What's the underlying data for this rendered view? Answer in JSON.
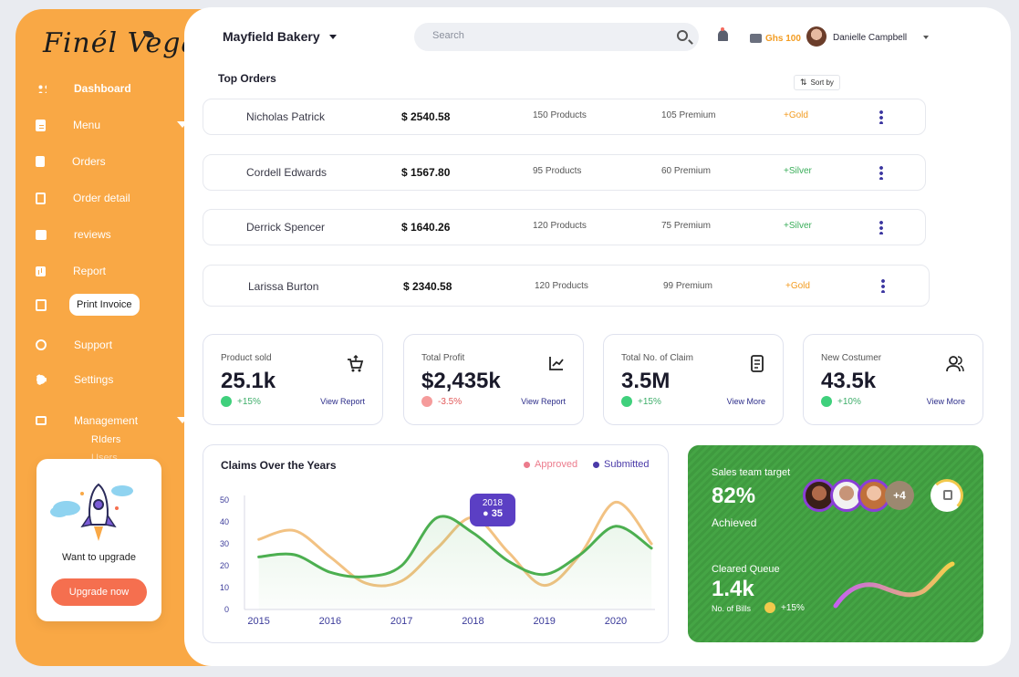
{
  "brand": {
    "logo_text": "Finél Vegan"
  },
  "sidebar": {
    "items": [
      {
        "label": "Dashboard",
        "icon": "grid-icon"
      },
      {
        "label": "Menu",
        "icon": "document-icon"
      },
      {
        "label": "Orders",
        "icon": "bookmark-icon"
      },
      {
        "label": "Order detail",
        "icon": "clipboard-icon"
      },
      {
        "label": "reviews",
        "icon": "edit-icon"
      },
      {
        "label": "Report",
        "icon": "bar-chart-icon"
      },
      {
        "label": "Print Invoice",
        "icon": "invoice-icon"
      },
      {
        "label": "Support",
        "icon": "support-icon"
      },
      {
        "label": "Settings",
        "icon": "gear-icon"
      },
      {
        "label": "Management",
        "icon": "monitor-icon"
      }
    ],
    "sub_items": [
      "RIders",
      "Users"
    ]
  },
  "upgrade": {
    "text": "Want to upgrade",
    "button": "Upgrade now"
  },
  "header": {
    "store": "Mayfield Bakery",
    "search_placeholder": "Search",
    "balance": "Ghs 100",
    "user": "Danielle Campbell"
  },
  "orders": {
    "title": "Top Orders",
    "sort_label": "Sort by",
    "rows": [
      {
        "name": "Nicholas Patrick",
        "amount": "$ 2540.58",
        "products": "150 Products",
        "premium": "105 Premium",
        "tier": "+Gold"
      },
      {
        "name": "Cordell Edwards",
        "amount": "$ 1567.80",
        "products": "95 Products",
        "premium": "60 Premium",
        "tier": "+Silver"
      },
      {
        "name": "Derrick Spencer",
        "amount": "$ 1640.26",
        "products": "120 Products",
        "premium": "75 Premium",
        "tier": "+Silver"
      },
      {
        "name": "Larissa Burton",
        "amount": "$ 2340.58",
        "products": "120 Products",
        "premium": "99 Premium",
        "tier": "+Gold"
      }
    ]
  },
  "stats": [
    {
      "label": "Product sold",
      "value": "25.1k",
      "delta": "+15%",
      "link": "View Report",
      "icon": "cart-icon"
    },
    {
      "label": "Total Profit",
      "value": "$2,435k",
      "delta": "-3.5%",
      "link": "View Report",
      "icon": "trend-icon"
    },
    {
      "label": "Total No. of Claim",
      "value": "3.5M",
      "delta": "+15%",
      "link": "View More",
      "icon": "receipt-icon"
    },
    {
      "label": "New Costumer",
      "value": "43.5k",
      "delta": "+10%",
      "link": "View More",
      "icon": "users-icon"
    }
  ],
  "claims": {
    "title": "Claims Over the Years",
    "tooltip_year": "2018",
    "tooltip_value": "● 35"
  },
  "chart_data": {
    "type": "line",
    "title": "Claims Over the Years",
    "x": [
      2015,
      2015.5,
      2016,
      2016.5,
      2017,
      2017.5,
      2018,
      2018.5,
      2019,
      2019.5,
      2020,
      2020.5
    ],
    "ylim": [
      0,
      50
    ],
    "yticks": [
      0,
      10,
      20,
      30,
      40,
      50
    ],
    "xticks": [
      2015,
      2016,
      2017,
      2018,
      2019,
      2020
    ],
    "series": [
      {
        "name": "Approved",
        "color": "#f2c283",
        "values": [
          32,
          36,
          24,
          12,
          13,
          28,
          42,
          26,
          11,
          25,
          49,
          30
        ]
      },
      {
        "name": "Submitted",
        "color": "#4caf50",
        "values": [
          24,
          25,
          17,
          15,
          20,
          42,
          35,
          22,
          16,
          25,
          38,
          28
        ]
      }
    ],
    "legend_colors": {
      "Approved": "#ec7b8c",
      "Submitted": "#4a3aa8"
    }
  },
  "team": {
    "target_label": "Sales team target",
    "percent": "82%",
    "achieved_label": "Achieved",
    "more_count": "+4",
    "queue_label": "Cleared Queue",
    "queue_value": "1.4k",
    "bills_label": "No. of Bills",
    "bills_delta": "+15%"
  }
}
